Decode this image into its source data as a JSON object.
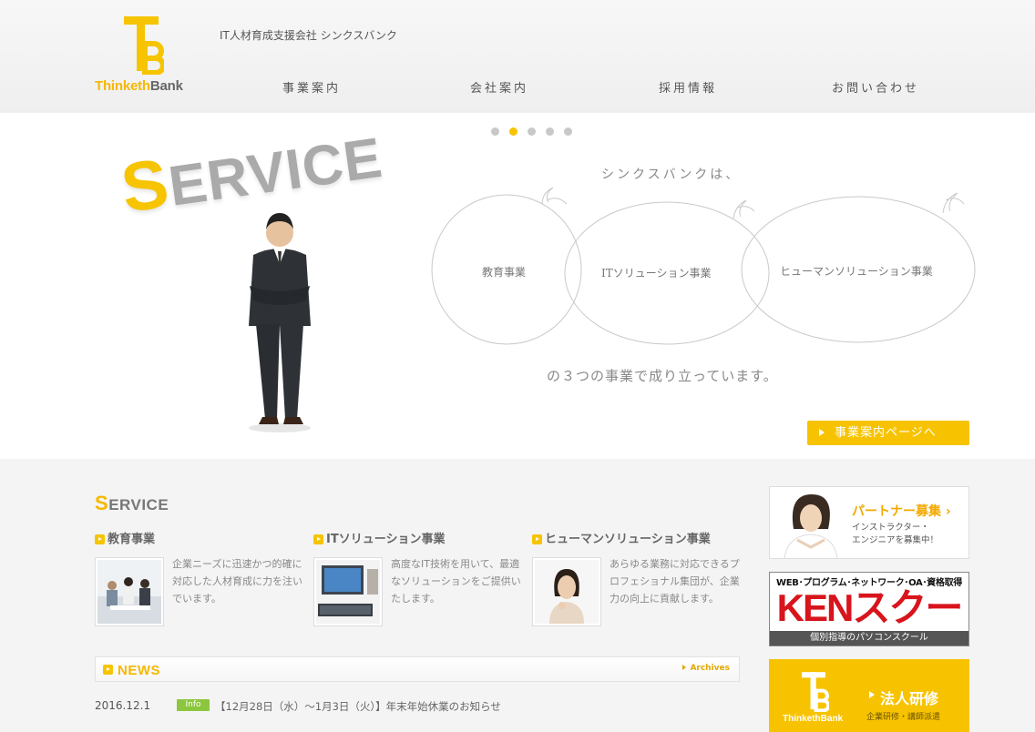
{
  "colors": {
    "accent": "#f6c400",
    "info_badge": "#8cc63e",
    "ken_red": "#d8141c"
  },
  "header": {
    "logo_text_a": "Thinketh",
    "logo_text_b": "Bank",
    "tagline": "IT人材育成支援会社 シンクスバンク",
    "nav": [
      "事業案内",
      "会社案内",
      "採用情報",
      "お問い合わせ"
    ]
  },
  "hero": {
    "slide_count": 5,
    "active_slide": 2,
    "service_s": "S",
    "service_rest": "ERVICE",
    "title": "シンクスバンクは、",
    "businesses": [
      "教育事業",
      "ITソリューション事業",
      "ヒューマンソリューション事業"
    ],
    "subtitle": "の３つの事業で成り立っています。",
    "button": "事業案内ページへ"
  },
  "service": {
    "title_s": "S",
    "title_rest": "ERVICE",
    "items": [
      {
        "title": "教育事業",
        "text": "企業ニーズに迅速かつ的確に対応した人材育成に力を注いでいます。",
        "image": "meeting-photo"
      },
      {
        "title": "ITソリューション事業",
        "text": "高度なIT技術を用いて、最適なソリューションをご提供いたします。",
        "image": "computer-photo"
      },
      {
        "title": "ヒューマンソリューション事業",
        "text": "あらゆる業務に対応できるプロフェショナル集団が、企業力の向上に貢献します。",
        "image": "woman-photo"
      }
    ]
  },
  "news": {
    "title_n": "N",
    "title_rest": "EWS",
    "archives": "Archives",
    "items": [
      {
        "date": "2016.12.1",
        "badge": "Info",
        "text": "【12月28日（水）～1月3日（火）】年末年始休業のお知らせ"
      }
    ]
  },
  "sidebar": {
    "partner": {
      "title": "パートナー募集",
      "line1": "インストラクター・",
      "line2": "エンジニアを募集中！"
    },
    "ken": {
      "top": "WEB･プログラム･ネットワーク･OA･資格取得",
      "main": "KENスクール",
      "bottom": "個別指導のパソコンスクール"
    },
    "corporate": {
      "logo": "ThinkethBank",
      "title": "法人研修",
      "sub": "企業研修・講師派遣"
    }
  }
}
